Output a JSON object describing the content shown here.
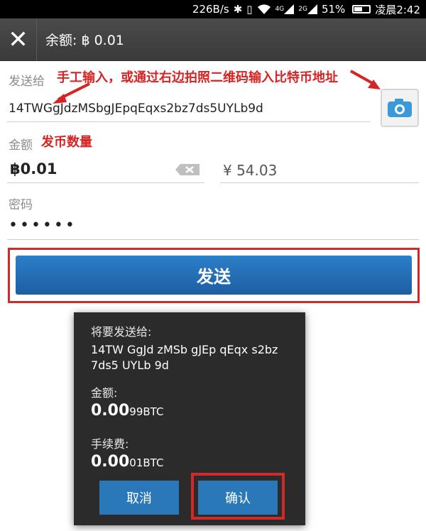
{
  "status_bar": {
    "speed": "226B/s",
    "battery": "51%",
    "time": "凌晨2:42",
    "net_4g": "4G",
    "net_2g": "2G"
  },
  "header": {
    "title": "余额: ฿ 0.01"
  },
  "form": {
    "to_label": "发送给",
    "to_annotation": "手工输入，或通过右边拍照二维码输入比特币地址",
    "address": "14TWGgJdzMSbgJEpqEqxs2bz7ds5UYLb9d",
    "amount_label": "金额",
    "amount_annotation": "发币数量",
    "amount_btc": "฿0.01",
    "amount_cny": "¥ 54.03",
    "password_label": "密码",
    "password_value": "••••••",
    "send_label": "发送"
  },
  "dialog": {
    "to_label": "将要发送给:",
    "address_line1": "14TW GgJd zMSb gJEp qEqx s2bz",
    "address_line2": "7ds5 UYLb 9d",
    "amount_label": "金额:",
    "amount_main": "0.00",
    "amount_tail": "99",
    "amount_unit": "BTC",
    "fee_label": "手续费:",
    "fee_main": "0.00",
    "fee_tail": "01",
    "fee_unit": "BTC",
    "cancel_label": "取消",
    "confirm_label": "确认"
  },
  "colors": {
    "annotation_red": "#d62424",
    "send_blue": "#1d5ea2",
    "dialog_bg": "#2b2b2b",
    "dialog_button": "#2b78b9"
  }
}
